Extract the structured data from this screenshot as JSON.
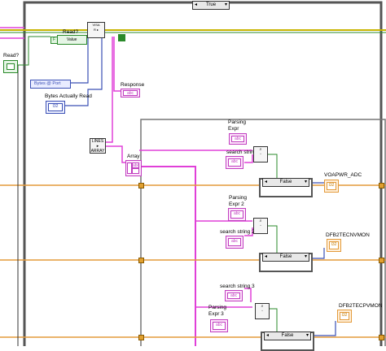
{
  "outer_case": {
    "selector": "True"
  },
  "top": {
    "read_label": "Read?",
    "value_label": "Value",
    "bool_const": "F"
  },
  "left": {
    "read_button_label": "Read?",
    "bytes_at_port": "Bytes @ Port",
    "bytes_actually_read": "Bytes Actually Read",
    "bytes_actually_read_type": "I32",
    "response_label": "Response",
    "response_type": "abc",
    "lines_to_array": "LINES ▸ ARRAY",
    "array_label": "Array",
    "array_type": "abc"
  },
  "blocks": [
    {
      "parsing_label": "Parsing Expr",
      "search_label": "search string",
      "case_value": "False",
      "indicator": "VOAPWR_ADC",
      "indicator_type": "I32"
    },
    {
      "parsing_label": "Parsing Expr 2",
      "search_label": "search string 2",
      "case_value": "False",
      "indicator": "DFB2TECNVMON",
      "indicator_type": "I32"
    },
    {
      "parsing_label": "Parsing Expr 3",
      "search_label": "search string 3",
      "case_value": "False",
      "indicator": "DFB2TECPVMON",
      "indicator_type": "I32"
    }
  ],
  "const_type": "abc",
  "colors": {
    "string_wire": "#e040d8",
    "numeric_wire": "#3a4fb5",
    "bool_wire": "#2a8a2a",
    "error_wire": "#c8b400",
    "orange_wire": "#e39a3a",
    "frame": "#444444"
  }
}
